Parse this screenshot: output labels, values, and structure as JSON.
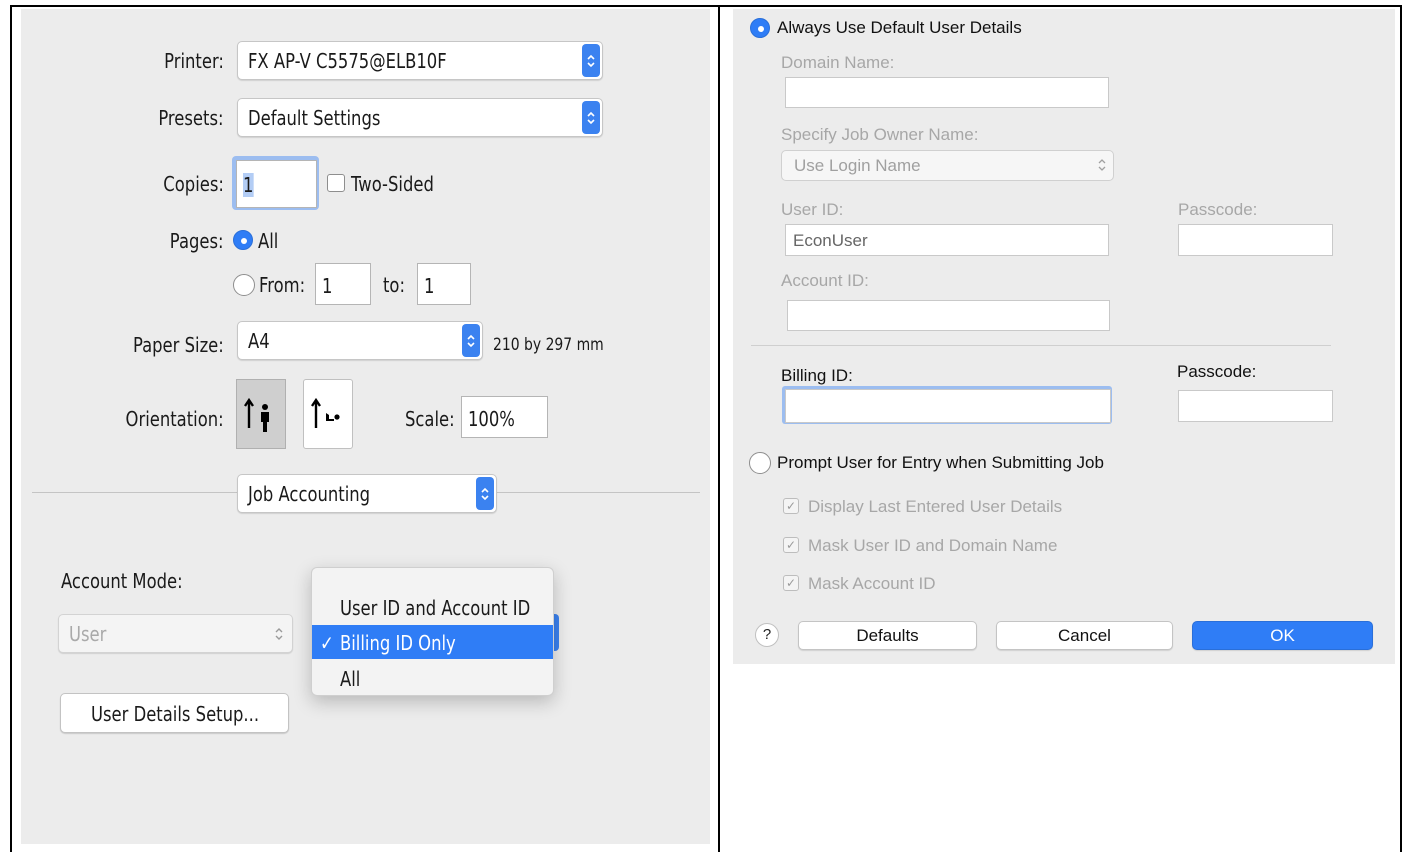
{
  "print_dialog": {
    "printer": {
      "label": "Printer:",
      "value": "FX AP-V C5575@ELB10F"
    },
    "presets": {
      "label": "Presets:",
      "value": "Default Settings"
    },
    "copies": {
      "label": "Copies:",
      "value": "1",
      "two_sided_label": "Two-Sided"
    },
    "pages": {
      "label": "Pages:",
      "all_label": "All",
      "from_label": "From:",
      "from_value": "1",
      "to_label": "to:",
      "to_value": "1"
    },
    "paper_size": {
      "label": "Paper Size:",
      "value": "A4",
      "dimensions": "210 by 297 mm"
    },
    "orientation": {
      "label": "Orientation:"
    },
    "scale": {
      "label": "Scale:",
      "value": "100%"
    },
    "section_popup": {
      "value": "Job Accounting"
    },
    "account_mode": {
      "label": "Account Mode:",
      "value": "User"
    },
    "menu": {
      "items": [
        {
          "label": "User ID and Account ID"
        },
        {
          "label": "Billing ID Only",
          "check": "✓"
        },
        {
          "label": "All"
        }
      ]
    },
    "user_details_button": "User Details Setup..."
  },
  "user_details": {
    "option_default": "Always Use Default User Details",
    "domain_name": {
      "label": "Domain Name:",
      "value": ""
    },
    "job_owner": {
      "label": "Specify Job Owner Name:",
      "value": "Use Login Name"
    },
    "user_id": {
      "label": "User ID:",
      "value": "EconUser"
    },
    "passcode1": {
      "label": "Passcode:",
      "value": ""
    },
    "account_id": {
      "label": "Account ID:",
      "value": ""
    },
    "billing_id": {
      "label": "Billing ID:",
      "value": ""
    },
    "passcode2": {
      "label": "Passcode:",
      "value": ""
    },
    "option_prompt": "Prompt User for Entry when Submitting Job",
    "checkboxes": [
      {
        "label": "Display Last Entered User Details"
      },
      {
        "label": "Mask User ID and Domain Name"
      },
      {
        "label": "Mask Account ID"
      }
    ],
    "buttons": {
      "help": "?",
      "defaults": "Defaults",
      "cancel": "Cancel",
      "ok": "OK"
    }
  },
  "colors": {
    "accent": "#2f7df6",
    "panel_bg": "#ececec",
    "focus_ring": "#8fb3ee"
  }
}
